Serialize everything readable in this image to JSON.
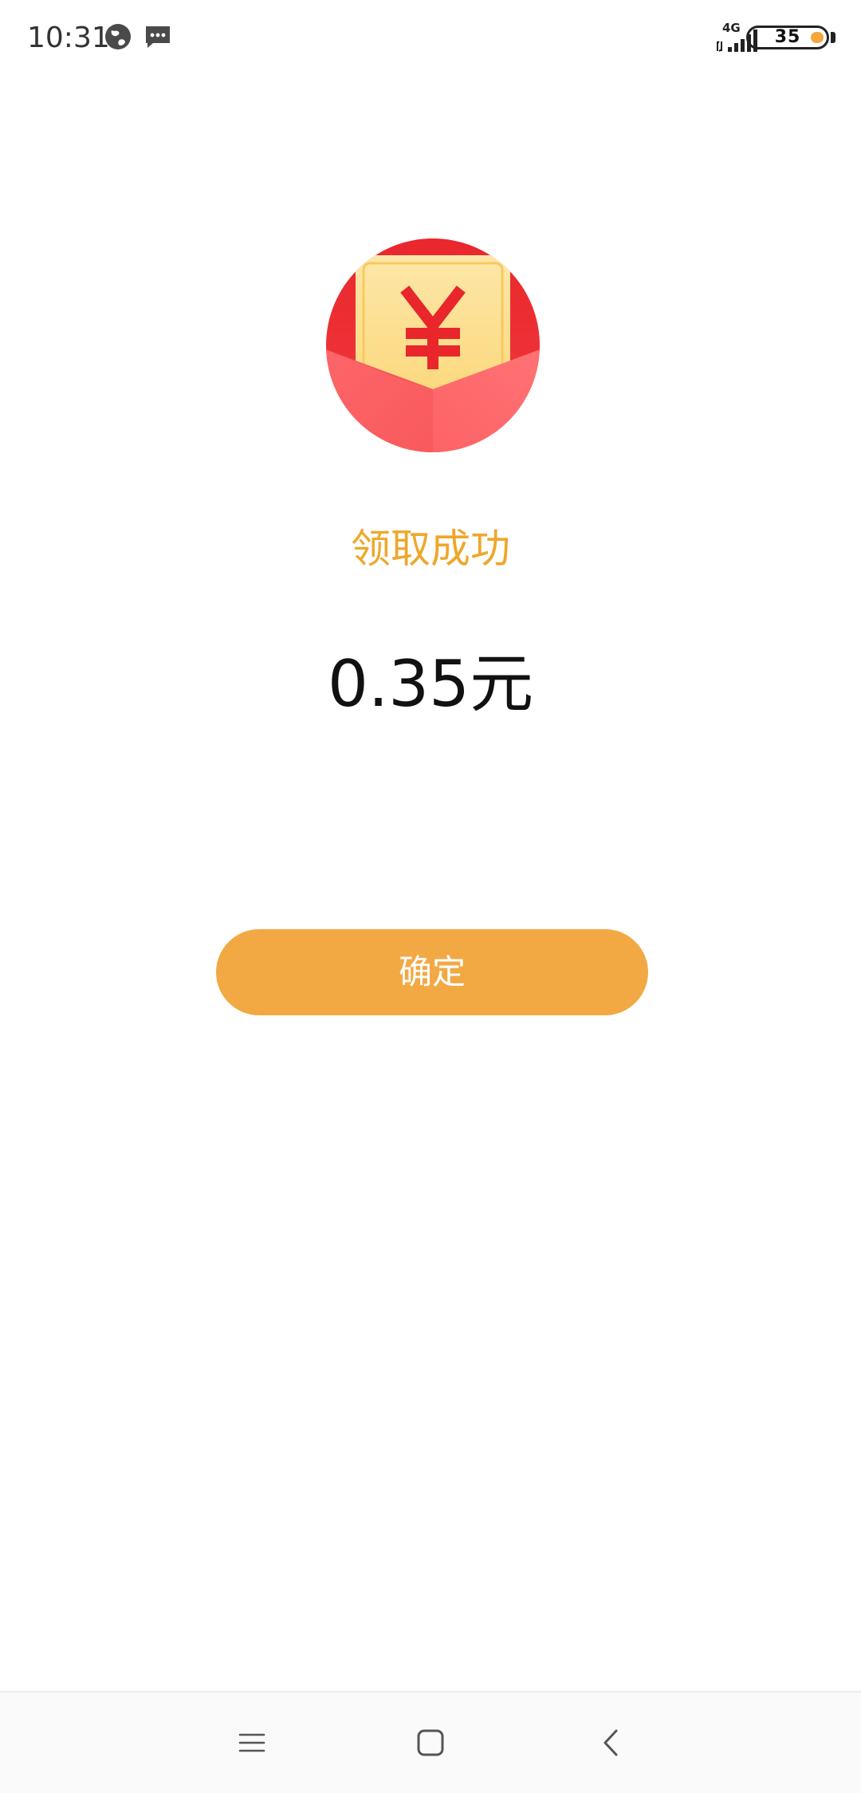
{
  "status_bar": {
    "time": "10:31",
    "network_label": "4G",
    "battery_level": "35",
    "icons": [
      "globe-icon",
      "message-icon",
      "signal-icon",
      "battery-icon"
    ]
  },
  "main": {
    "envelope_icon": "red-envelope-yuan-icon",
    "title": "领取成功",
    "amount": "0.35元",
    "confirm_label": "确定"
  },
  "nav_bar": {
    "items": [
      "menu-icon",
      "home-icon",
      "back-icon"
    ]
  },
  "colors": {
    "accent": "#f2a944",
    "title": "#eea72b",
    "envelope_red": "#e9272c"
  }
}
